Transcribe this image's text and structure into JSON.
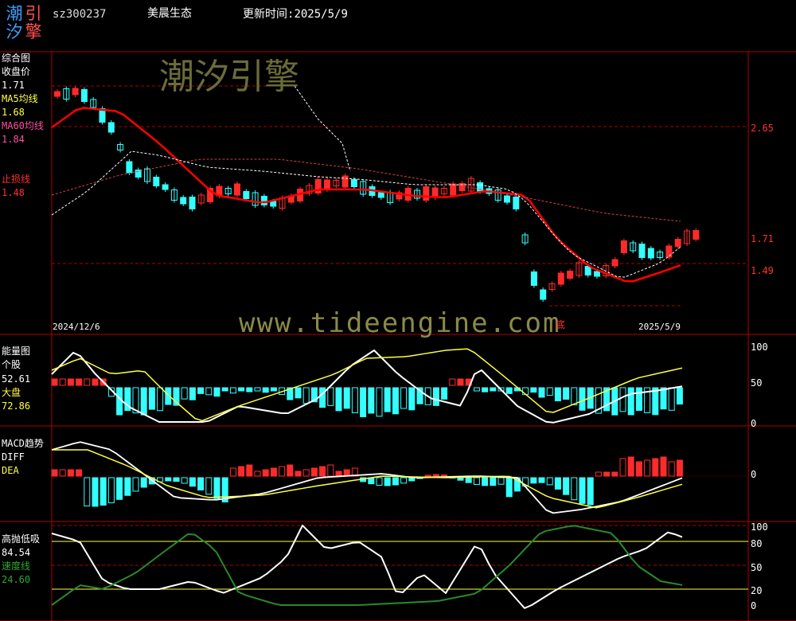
{
  "header": {
    "code": "sz300237",
    "name": "美晨生态",
    "update_label": "更新时间:",
    "update_date": "2025/5/9",
    "logo_chars": [
      "潮",
      "引",
      "汐",
      "擎"
    ]
  },
  "watermarks": {
    "brand": "潮汐引擎",
    "url": "www.tideengine.com"
  },
  "main_panel": {
    "title": "综合图",
    "close_label": "收盘价",
    "close_value": "1.71",
    "ma5_label": "MA5均线",
    "ma5_value": "1.68",
    "ma60_label": "MA60均线",
    "ma60_value": "1.84",
    "stop_label": "止损线",
    "stop_value": "1.48",
    "price_ticks": [
      "2.65",
      "1.71",
      "1.49"
    ],
    "date_start": "2024/12/6",
    "date_end": "2025/5/9",
    "bottom_mark": "底"
  },
  "energy_panel": {
    "title": "能量图",
    "stock_label": "个股",
    "stock_value": "52.61",
    "market_label": "大盘",
    "market_value": "72.86",
    "ticks": [
      "100",
      "50",
      "0"
    ]
  },
  "macd_panel": {
    "title": "MACD趋势",
    "diff_label": "DIFF",
    "dea_label": "DEA",
    "ticks": [
      "0"
    ]
  },
  "osc_panel": {
    "title": "高抛低吸",
    "value": "84.54",
    "speed_label": "速度线",
    "speed_value": "24.60",
    "ticks": [
      "100",
      "80",
      "50",
      "20",
      "0"
    ]
  },
  "colors": {
    "up": "#ff2a2a",
    "down": "#33ffff",
    "axis": "#b00000",
    "ma5": "#ff0000",
    "ma60": "#d04040",
    "label_red": "#ff3030",
    "yellow": "#ffff44",
    "white": "#ffffff",
    "green": "#2a8a2a"
  }
}
